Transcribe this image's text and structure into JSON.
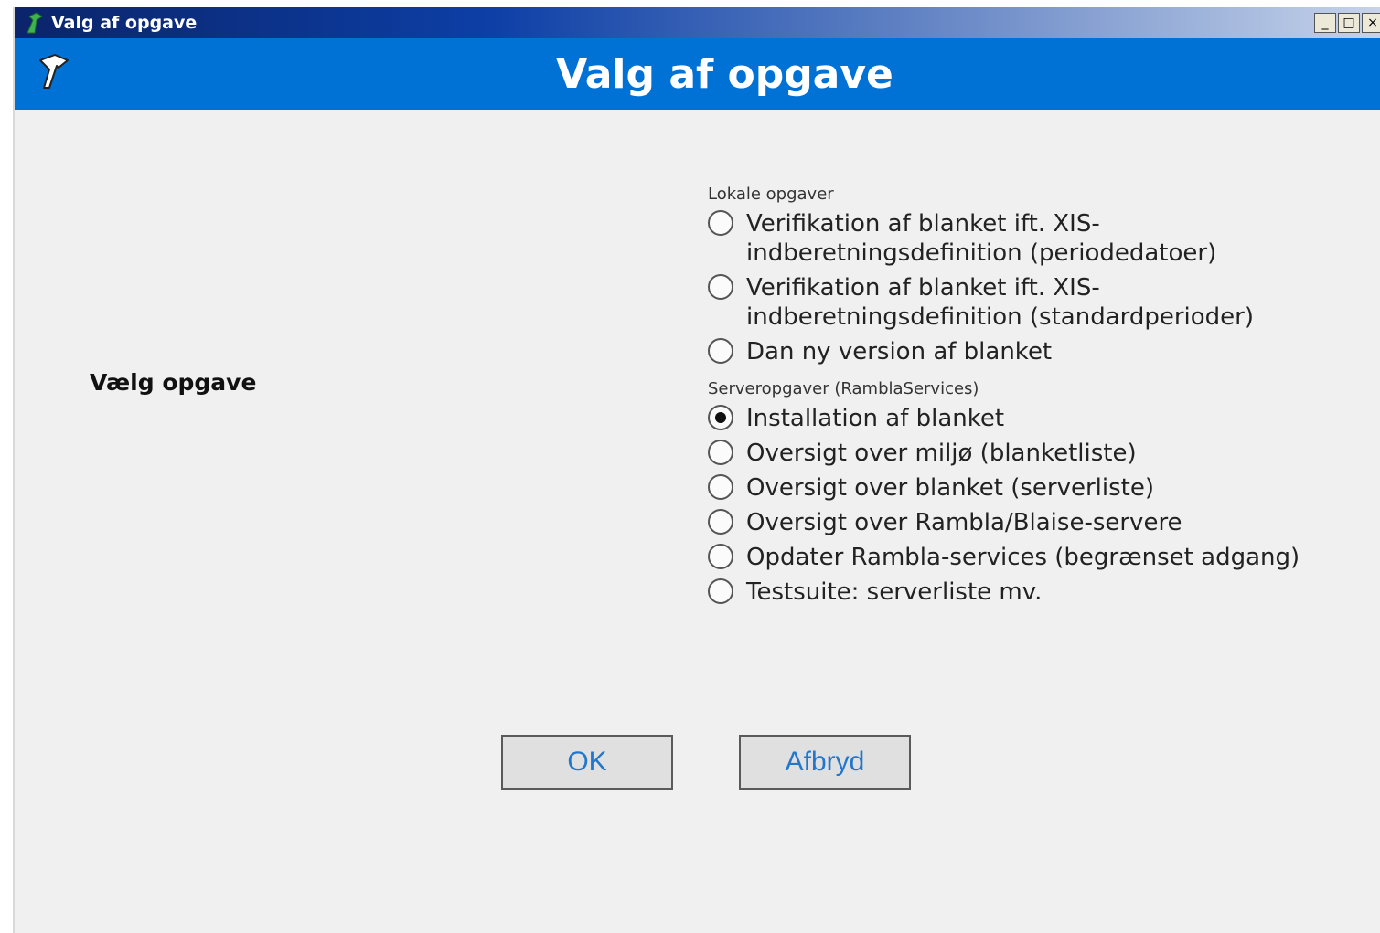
{
  "window": {
    "title": "Valg af opgave",
    "controls": [
      "_",
      "□",
      "×"
    ]
  },
  "banner": {
    "heading": "Valg af opgave"
  },
  "task_label": "Vælg opgave",
  "local_group": {
    "caption": "Lokale opgaver",
    "options": [
      {
        "label": "Verifikation af blanket ift. XIS-indberetningsdefinition (periodedatoer)",
        "checked": false
      },
      {
        "label": "Verifikation af blanket ift. XIS-indberetningsdefinition (standardperioder)",
        "checked": false
      },
      {
        "label": "Dan ny version af blanket",
        "checked": false
      }
    ]
  },
  "server_group": {
    "caption": "Serveropgaver (RamblaServices)",
    "options": [
      {
        "label": "Installation af blanket",
        "checked": true
      },
      {
        "label": "Oversigt over miljø (blanketliste)",
        "checked": false
      },
      {
        "label": "Oversigt over blanket (serverliste)",
        "checked": false
      },
      {
        "label": "Oversigt over Rambla/Blaise-servere",
        "checked": false
      },
      {
        "label": "Opdater Rambla-services (begrænset adgang)",
        "checked": false
      },
      {
        "label": "Testsuite: serverliste mv.",
        "checked": false
      }
    ]
  },
  "buttons": {
    "ok": "OK",
    "cancel": "Afbryd"
  }
}
